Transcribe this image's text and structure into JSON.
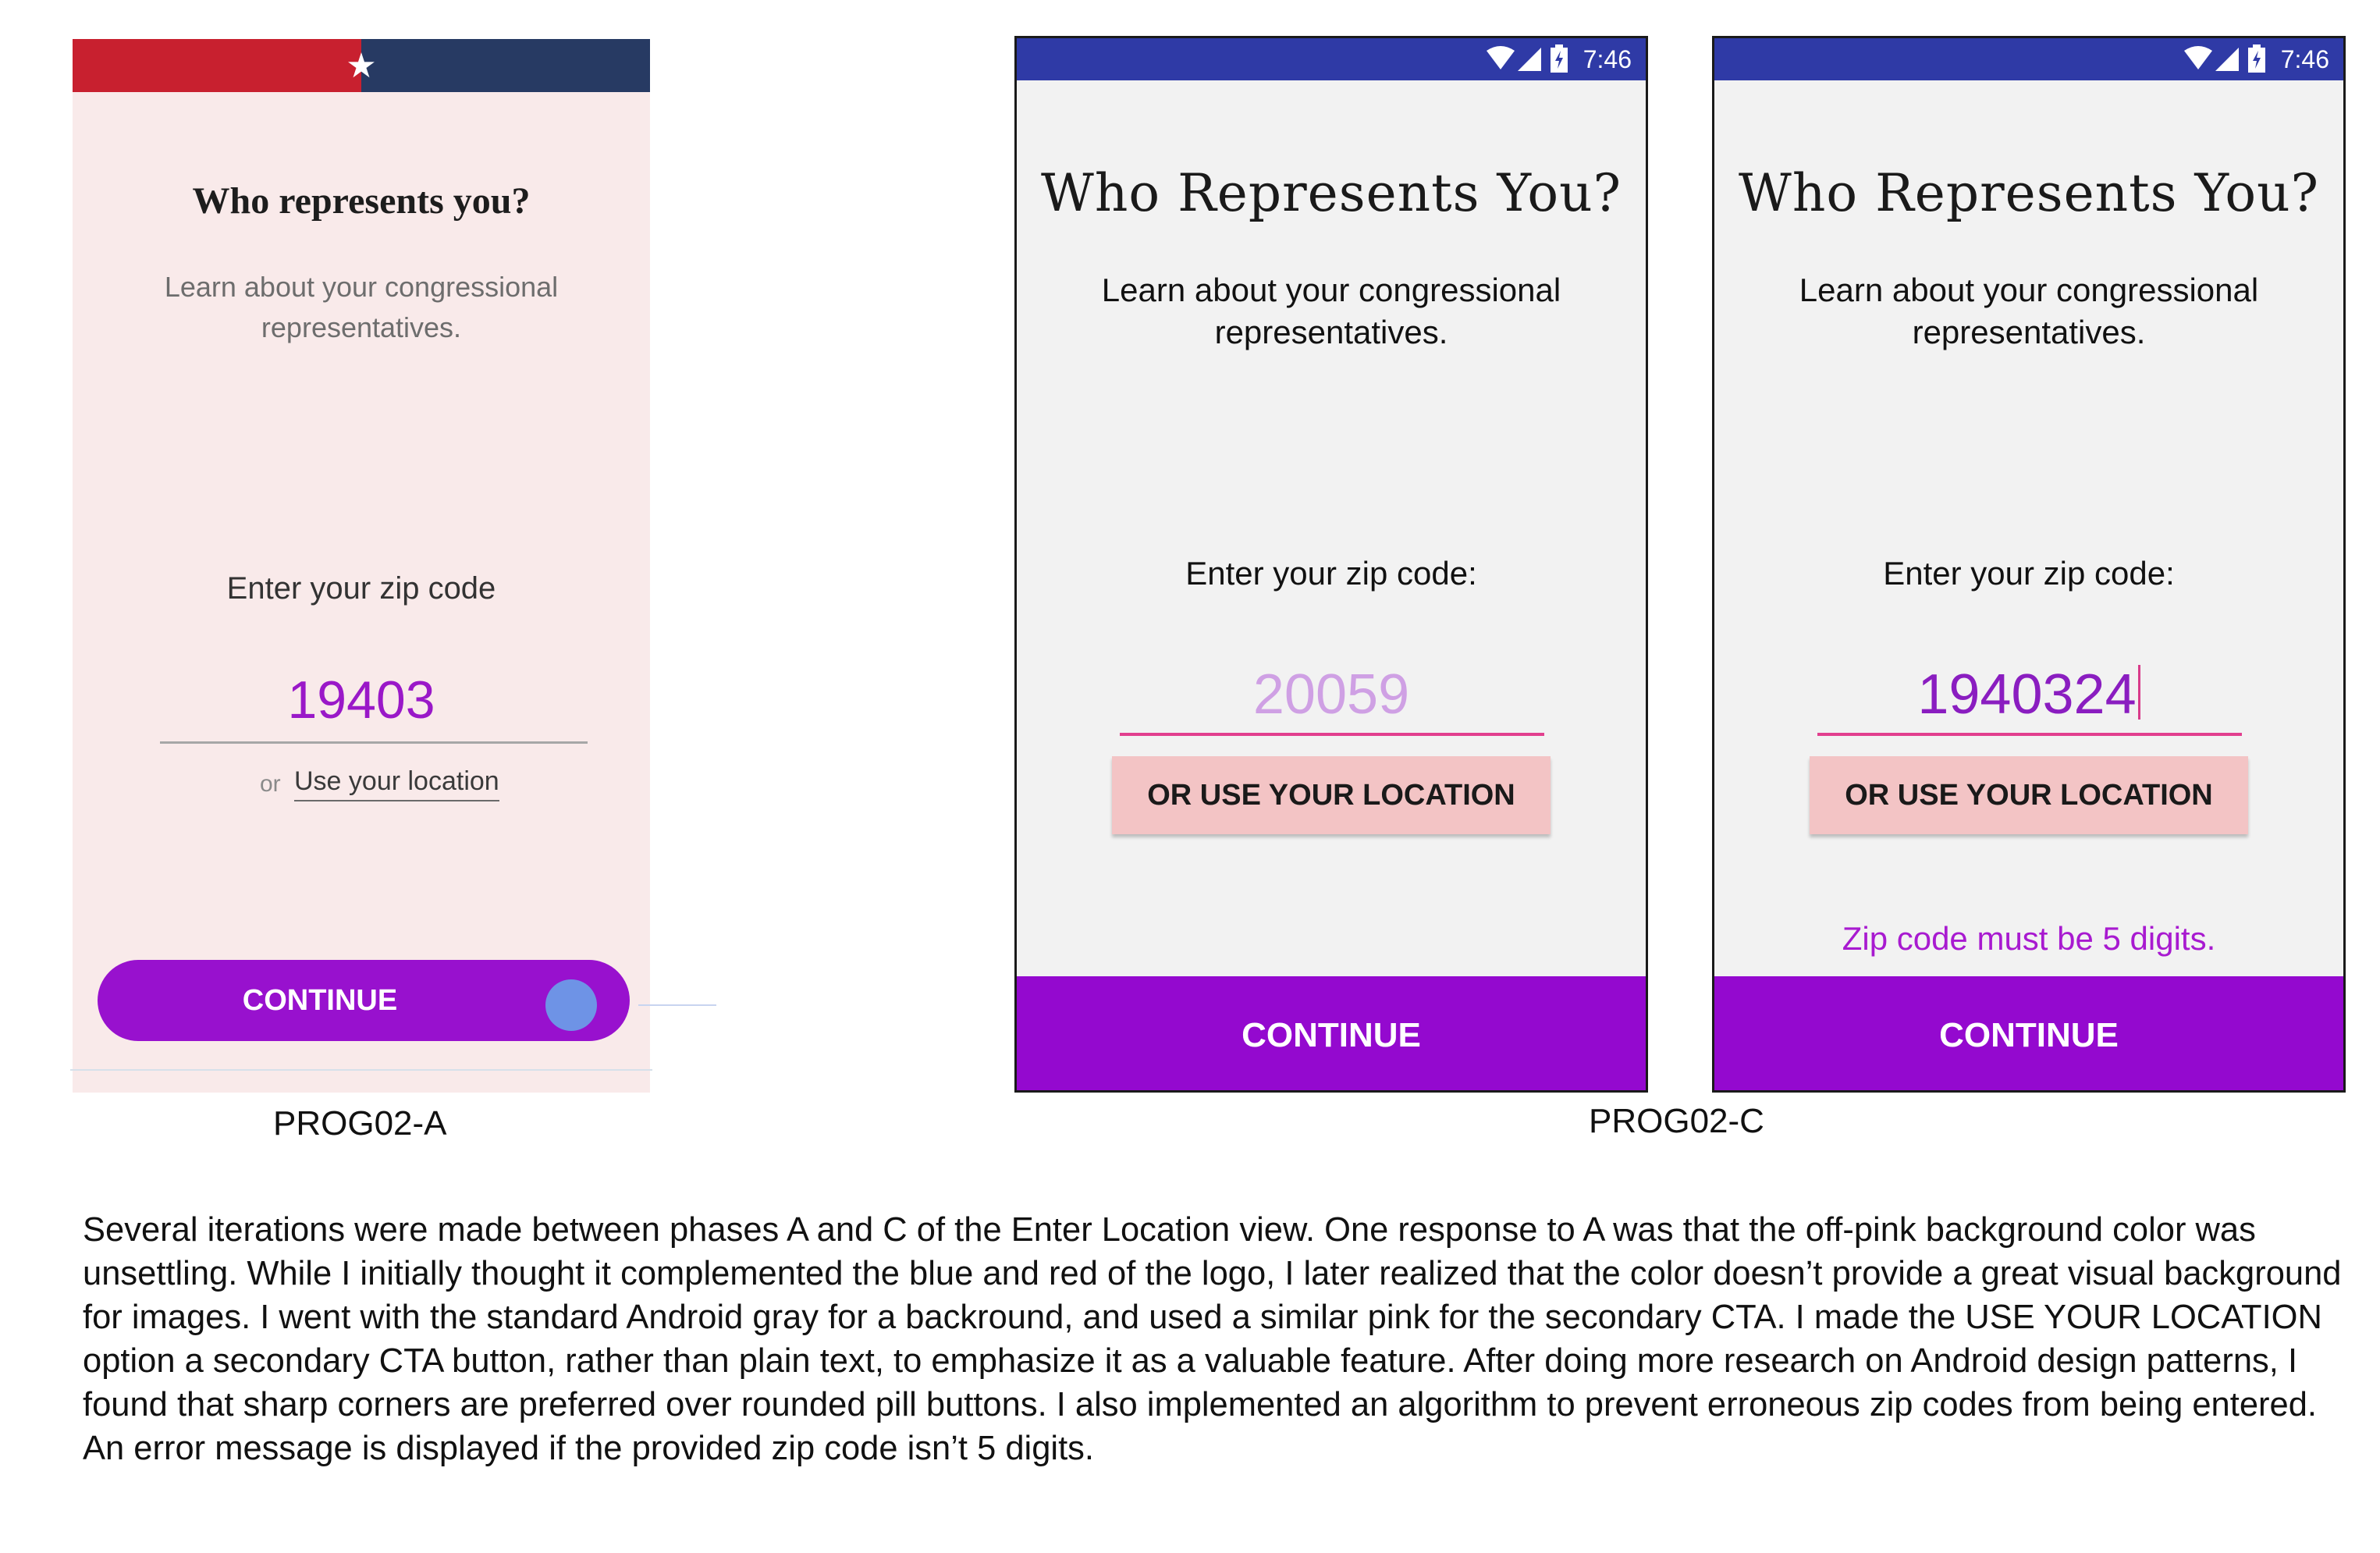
{
  "prog02_a": {
    "title": "Who represents you?",
    "subtitle": "Learn about your congressional representatives.",
    "zip_label": "Enter your zip code",
    "zip_value": "19403",
    "or_text": "or",
    "use_location": "Use your location",
    "continue": "CONTINUE",
    "star_glyph": "★",
    "colors": {
      "background": "#f9eaea",
      "logo_red": "#c8202f",
      "logo_blue": "#273a63",
      "accent": "#9811ce"
    }
  },
  "prog02_c": {
    "status_time": "7:46",
    "status_icons": [
      "wifi-icon",
      "signal-icon",
      "battery-icon"
    ],
    "title": "Who Represents You?",
    "subtitle": "Learn about your congressional representatives.",
    "zip_label": "Enter your zip code:",
    "location_button": "OR USE YOUR LOCATION",
    "continue": "CONTINUE",
    "screen_1": {
      "zip_placeholder": "20059"
    },
    "screen_2": {
      "zip_value": "1940324",
      "error": "Zip code must be 5 digits."
    },
    "colors": {
      "status_bar": "#2f3aa6",
      "background": "#f2f2f2",
      "secondary_cta": "#f3c4c5",
      "primary_cta": "#9409cf",
      "placeholder": "#cfa0e4",
      "input_text": "#8a1dc0",
      "error": "#a81ad0",
      "underline": "#e23f8e"
    }
  },
  "captions": {
    "a": "PROG02-A",
    "c": "PROG02-C"
  },
  "description": "Several iterations were made between phases A and C of the Enter Location view. One response to A was that the off-pink background color was unsettling. While I initially thought it complemented the blue and red of the logo, I later realized that the color doesn’t provide a great visual background for images. I went with the standard Android gray for a backround, and used a similar pink for the secondary CTA. I made the USE YOUR LOCATION option a secondary CTA button, rather than plain text, to emphasize it as a valuable feature. After doing more research on Android design patterns, I found that sharp corners are preferred over rounded pill buttons. I also implemented an algorithm to prevent erroneous zip codes from being entered. An error message is displayed if the provided zip code isn’t 5 digits."
}
